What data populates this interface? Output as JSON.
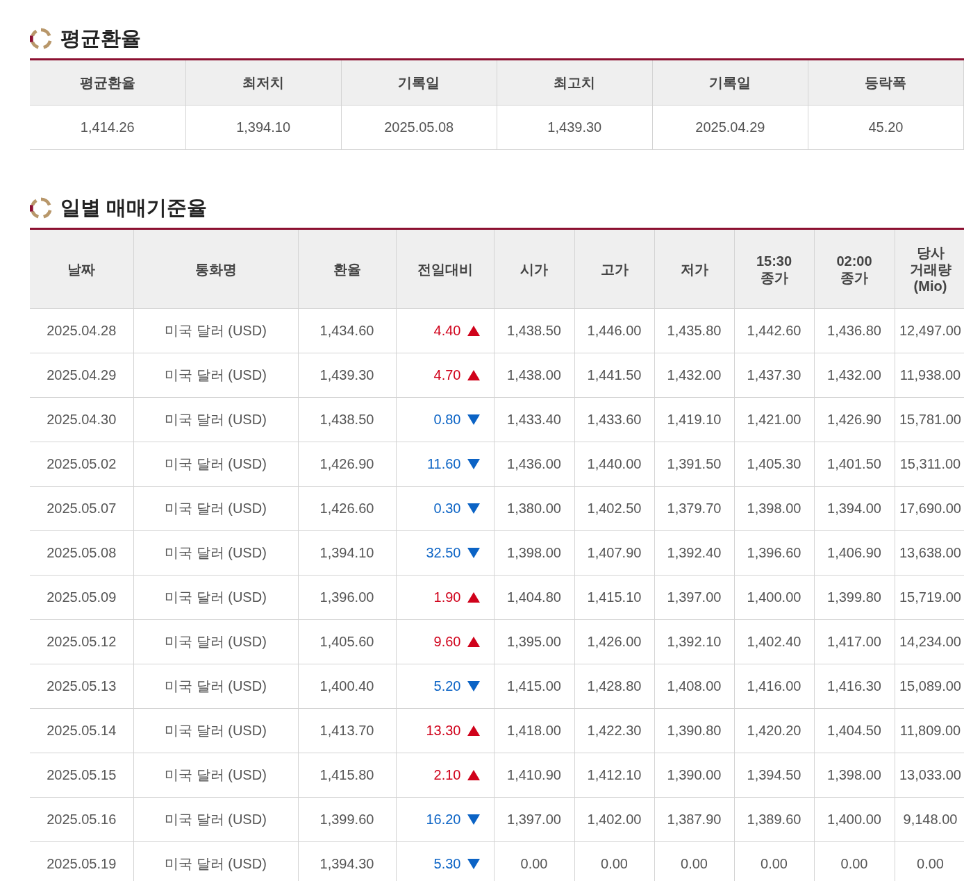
{
  "average_section": {
    "title": "평균환율",
    "columns": [
      "평균환율",
      "최저치",
      "기록일",
      "최고치",
      "기록일",
      "등락폭"
    ],
    "values": [
      "1,414.26",
      "1,394.10",
      "2025.05.08",
      "1,439.30",
      "2025.04.29",
      "45.20"
    ]
  },
  "daily_section": {
    "title": "일별 매매기준율",
    "columns": [
      "날짜",
      "통화명",
      "환율",
      "전일대비",
      "시가",
      "고가",
      "저가",
      "15:30\n종가",
      "02:00\n종가",
      "당사\n거래량\n(Mio)"
    ],
    "rows": [
      {
        "date": "2025.04.28",
        "currency": "미국 달러 (USD)",
        "rate": "1,434.60",
        "change": "4.40",
        "rising": true,
        "open": "1,438.50",
        "high": "1,446.00",
        "low": "1,435.80",
        "close_1530": "1,442.60",
        "close_0200": "1,436.80",
        "volume": "12,497.00"
      },
      {
        "date": "2025.04.29",
        "currency": "미국 달러 (USD)",
        "rate": "1,439.30",
        "change": "4.70",
        "rising": true,
        "open": "1,438.00",
        "high": "1,441.50",
        "low": "1,432.00",
        "close_1530": "1,437.30",
        "close_0200": "1,432.00",
        "volume": "11,938.00"
      },
      {
        "date": "2025.04.30",
        "currency": "미국 달러 (USD)",
        "rate": "1,438.50",
        "change": "0.80",
        "rising": false,
        "open": "1,433.40",
        "high": "1,433.60",
        "low": "1,419.10",
        "close_1530": "1,421.00",
        "close_0200": "1,426.90",
        "volume": "15,781.00"
      },
      {
        "date": "2025.05.02",
        "currency": "미국 달러 (USD)",
        "rate": "1,426.90",
        "change": "11.60",
        "rising": false,
        "open": "1,436.00",
        "high": "1,440.00",
        "low": "1,391.50",
        "close_1530": "1,405.30",
        "close_0200": "1,401.50",
        "volume": "15,311.00"
      },
      {
        "date": "2025.05.07",
        "currency": "미국 달러 (USD)",
        "rate": "1,426.60",
        "change": "0.30",
        "rising": false,
        "open": "1,380.00",
        "high": "1,402.50",
        "low": "1,379.70",
        "close_1530": "1,398.00",
        "close_0200": "1,394.00",
        "volume": "17,690.00"
      },
      {
        "date": "2025.05.08",
        "currency": "미국 달러 (USD)",
        "rate": "1,394.10",
        "change": "32.50",
        "rising": false,
        "open": "1,398.00",
        "high": "1,407.90",
        "low": "1,392.40",
        "close_1530": "1,396.60",
        "close_0200": "1,406.90",
        "volume": "13,638.00"
      },
      {
        "date": "2025.05.09",
        "currency": "미국 달러 (USD)",
        "rate": "1,396.00",
        "change": "1.90",
        "rising": true,
        "open": "1,404.80",
        "high": "1,415.10",
        "low": "1,397.00",
        "close_1530": "1,400.00",
        "close_0200": "1,399.80",
        "volume": "15,719.00"
      },
      {
        "date": "2025.05.12",
        "currency": "미국 달러 (USD)",
        "rate": "1,405.60",
        "change": "9.60",
        "rising": true,
        "open": "1,395.00",
        "high": "1,426.00",
        "low": "1,392.10",
        "close_1530": "1,402.40",
        "close_0200": "1,417.00",
        "volume": "14,234.00"
      },
      {
        "date": "2025.05.13",
        "currency": "미국 달러 (USD)",
        "rate": "1,400.40",
        "change": "5.20",
        "rising": false,
        "open": "1,415.00",
        "high": "1,428.80",
        "low": "1,408.00",
        "close_1530": "1,416.00",
        "close_0200": "1,416.30",
        "volume": "15,089.00"
      },
      {
        "date": "2025.05.14",
        "currency": "미국 달러 (USD)",
        "rate": "1,413.70",
        "change": "13.30",
        "rising": true,
        "open": "1,418.00",
        "high": "1,422.30",
        "low": "1,390.80",
        "close_1530": "1,420.20",
        "close_0200": "1,404.50",
        "volume": "11,809.00"
      },
      {
        "date": "2025.05.15",
        "currency": "미국 달러 (USD)",
        "rate": "1,415.80",
        "change": "2.10",
        "rising": true,
        "open": "1,410.90",
        "high": "1,412.10",
        "low": "1,390.00",
        "close_1530": "1,394.50",
        "close_0200": "1,398.00",
        "volume": "13,033.00"
      },
      {
        "date": "2025.05.16",
        "currency": "미국 달러 (USD)",
        "rate": "1,399.60",
        "change": "16.20",
        "rising": false,
        "open": "1,397.00",
        "high": "1,402.00",
        "low": "1,387.90",
        "close_1530": "1,389.60",
        "close_0200": "1,400.00",
        "volume": "9,148.00"
      },
      {
        "date": "2025.05.19",
        "currency": "미국 달러 (USD)",
        "rate": "1,394.30",
        "change": "5.30",
        "rising": false,
        "open": "0.00",
        "high": "0.00",
        "low": "0.00",
        "close_1530": "0.00",
        "close_0200": "0.00",
        "volume": "0.00"
      }
    ]
  }
}
